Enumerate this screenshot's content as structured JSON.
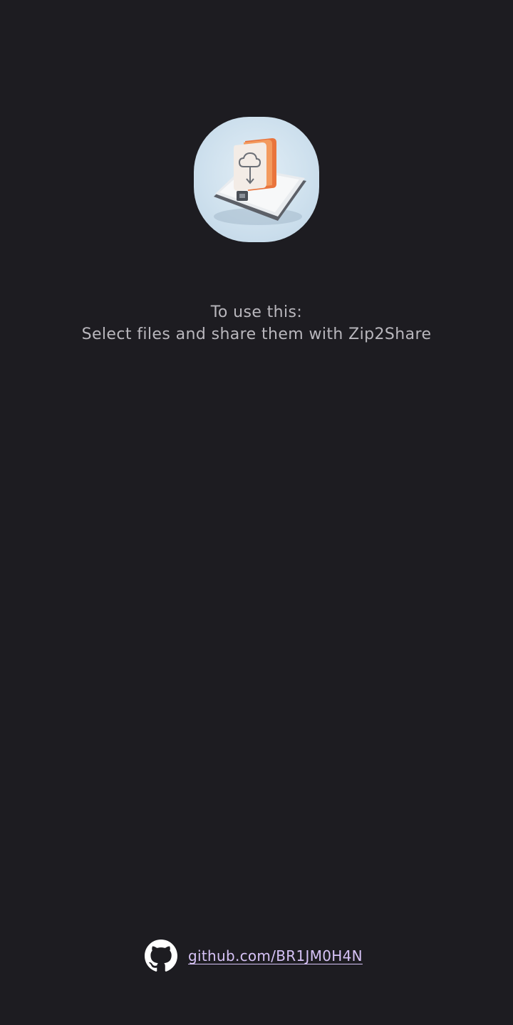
{
  "app": {
    "icon_name": "zip2share-app-icon"
  },
  "instructions": {
    "line1": "To use this:",
    "line2": "Select files and share them with Zip2Share"
  },
  "footer": {
    "icon_name": "github-icon",
    "link_text": "github.com/BR1JM0H4N"
  },
  "colors": {
    "background": "#1d1c21",
    "text": "#b9b7bd",
    "link": "#d7c3f7"
  }
}
